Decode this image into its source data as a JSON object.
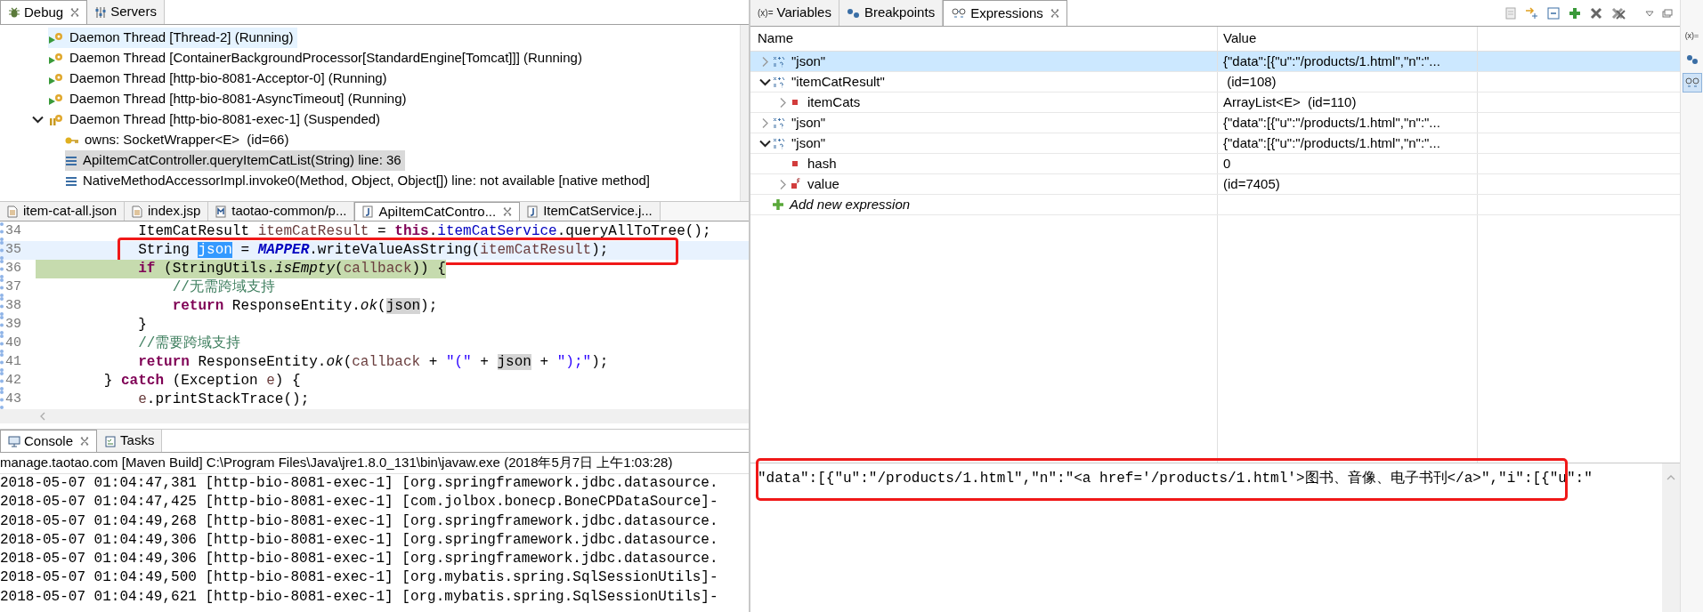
{
  "debug_view": {
    "tabs": [
      {
        "label": "Debug",
        "selected": true
      },
      {
        "label": "Servers",
        "selected": false
      }
    ],
    "threads": [
      {
        "label": "Daemon Thread [Thread-2] (Running)",
        "suspended": false,
        "hovered": true,
        "expanded": false
      },
      {
        "label": "Daemon Thread [ContainerBackgroundProcessor[StandardEngine[Tomcat]]] (Running)",
        "suspended": false,
        "hovered": false,
        "expanded": false
      },
      {
        "label": "Daemon Thread [http-bio-8081-Acceptor-0] (Running)",
        "suspended": false,
        "hovered": false,
        "expanded": false
      },
      {
        "label": "Daemon Thread [http-bio-8081-AsyncTimeout] (Running)",
        "suspended": false,
        "hovered": false,
        "expanded": false
      },
      {
        "label": "Daemon Thread [http-bio-8081-exec-1] (Suspended)",
        "suspended": true,
        "hovered": false,
        "expanded": true,
        "children": [
          {
            "kind": "monitor",
            "label": "owns: SocketWrapper<E>  (id=66)",
            "selected": false
          },
          {
            "kind": "frame",
            "label": "ApiItemCatController.queryItemCatList(String) line: 36",
            "selected": true
          },
          {
            "kind": "frame",
            "label": "NativeMethodAccessorImpl.invoke0(Method, Object, Object[]) line: not available [native method]",
            "selected": false
          }
        ]
      }
    ]
  },
  "editor": {
    "tabs": [
      {
        "label": "item-cat-all.json",
        "kind": "file",
        "selected": false
      },
      {
        "label": "index.jsp",
        "kind": "file",
        "selected": false
      },
      {
        "label": "taotao-common/p...",
        "kind": "maven",
        "selected": false
      },
      {
        "label": "ApiItemCatContro...",
        "kind": "java",
        "selected": true
      },
      {
        "label": "ItemCatService.j...",
        "kind": "java",
        "selected": false
      }
    ],
    "lines": [
      {
        "number": "34",
        "cursor": false,
        "current": false,
        "annotated": false,
        "tokens": [
          {
            "kind": "plain",
            "text": "            ItemCatResult "
          },
          {
            "kind": "local",
            "text": "itemCatResult"
          },
          {
            "kind": "plain",
            "text": " = "
          },
          {
            "kind": "keyword",
            "text": "this"
          },
          {
            "kind": "plain",
            "text": "."
          },
          {
            "kind": "field",
            "text": "itemCatService"
          },
          {
            "kind": "plain",
            "text": ".queryAllToTree();"
          }
        ]
      },
      {
        "number": "35",
        "cursor": true,
        "current": false,
        "annotated": true,
        "tokens": [
          {
            "kind": "plain",
            "text": "            String "
          },
          {
            "kind": "selection",
            "text": "json"
          },
          {
            "kind": "plain",
            "text": " = "
          },
          {
            "kind": "static-field",
            "text": "MAPPER"
          },
          {
            "kind": "plain",
            "text": ".writeValueAsString("
          },
          {
            "kind": "local",
            "text": "itemCatResult"
          },
          {
            "kind": "plain",
            "text": ");"
          }
        ]
      },
      {
        "number": "36",
        "cursor": false,
        "current": true,
        "annotated": false,
        "tokens": [
          {
            "kind": "keyword",
            "text": "            if"
          },
          {
            "kind": "plain",
            "text": " (StringUtils."
          },
          {
            "kind": "static-method",
            "text": "isEmpty"
          },
          {
            "kind": "plain",
            "text": "("
          },
          {
            "kind": "local",
            "text": "callback"
          },
          {
            "kind": "plain",
            "text": ")) {"
          }
        ]
      },
      {
        "number": "37",
        "cursor": false,
        "current": false,
        "annotated": false,
        "tokens": [
          {
            "kind": "comment",
            "text": "                //无需跨域支持"
          }
        ]
      },
      {
        "number": "38",
        "cursor": false,
        "current": false,
        "annotated": false,
        "tokens": [
          {
            "kind": "keyword",
            "text": "                return"
          },
          {
            "kind": "plain",
            "text": " ResponseEntity."
          },
          {
            "kind": "static-method",
            "text": "ok"
          },
          {
            "kind": "plain",
            "text": "("
          },
          {
            "kind": "occurrence",
            "text": "json"
          },
          {
            "kind": "plain",
            "text": ");"
          }
        ]
      },
      {
        "number": "39",
        "cursor": false,
        "current": false,
        "annotated": false,
        "tokens": [
          {
            "kind": "plain",
            "text": "            }"
          }
        ]
      },
      {
        "number": "40",
        "cursor": false,
        "current": false,
        "annotated": false,
        "tokens": [
          {
            "kind": "comment",
            "text": "            //需要跨域支持"
          }
        ]
      },
      {
        "number": "41",
        "cursor": false,
        "current": false,
        "annotated": false,
        "tokens": [
          {
            "kind": "keyword",
            "text": "            return"
          },
          {
            "kind": "plain",
            "text": " ResponseEntity."
          },
          {
            "kind": "static-method",
            "text": "ok"
          },
          {
            "kind": "plain",
            "text": "("
          },
          {
            "kind": "local",
            "text": "callback"
          },
          {
            "kind": "plain",
            "text": " + "
          },
          {
            "kind": "string",
            "text": "\"(\""
          },
          {
            "kind": "plain",
            "text": " + "
          },
          {
            "kind": "occurrence",
            "text": "json"
          },
          {
            "kind": "plain",
            "text": " + "
          },
          {
            "kind": "string",
            "text": "\");\""
          },
          {
            "kind": "plain",
            "text": ");"
          }
        ]
      },
      {
        "number": "42",
        "cursor": false,
        "current": false,
        "annotated": false,
        "tokens": [
          {
            "kind": "plain",
            "text": "        } "
          },
          {
            "kind": "keyword",
            "text": "catch"
          },
          {
            "kind": "plain",
            "text": " (Exception "
          },
          {
            "kind": "local",
            "text": "e"
          },
          {
            "kind": "plain",
            "text": ") {"
          }
        ]
      },
      {
        "number": "43",
        "cursor": false,
        "current": false,
        "annotated": false,
        "tokens": [
          {
            "kind": "local",
            "text": "            e"
          },
          {
            "kind": "plain",
            "text": ".printStackTrace();"
          }
        ]
      }
    ]
  },
  "console_view": {
    "tabs": [
      {
        "label": "Console",
        "kind": "console",
        "selected": true
      },
      {
        "label": "Tasks",
        "kind": "tasks",
        "selected": false
      }
    ],
    "header": "manage.taotao.com [Maven Build] C:\\Program Files\\Java\\jre1.8.0_131\\bin\\javaw.exe (2018年5月7日 上午1:03:28)",
    "lines": [
      "2018-05-07 01:04:47,381 [http-bio-8081-exec-1] [org.springframework.jdbc.datasource.",
      "2018-05-07 01:04:47,425 [http-bio-8081-exec-1] [com.jolbox.bonecp.BoneCPDataSource]-",
      "2018-05-07 01:04:49,268 [http-bio-8081-exec-1] [org.springframework.jdbc.datasource.",
      "2018-05-07 01:04:49,306 [http-bio-8081-exec-1] [org.springframework.jdbc.datasource.",
      "2018-05-07 01:04:49,306 [http-bio-8081-exec-1] [org.springframework.jdbc.datasource.",
      "2018-05-07 01:04:49,500 [http-bio-8081-exec-1] [org.mybatis.spring.SqlSessionUtils]-",
      "2018-05-07 01:04:49,621 [http-bio-8081-exec-1] [org.mybatis.spring.SqlSessionUtils]-"
    ]
  },
  "expressions_view": {
    "tabs": [
      {
        "label": "Variables",
        "kind": "variables",
        "icon_text": "(x)=",
        "selected": false
      },
      {
        "label": "Breakpoints",
        "kind": "breakpoints",
        "selected": false
      },
      {
        "label": "Expressions",
        "kind": "expressions",
        "selected": true
      }
    ],
    "columns": [
      "Name",
      "Value"
    ],
    "rows": [
      {
        "kind": "expression",
        "name": "\"json\"",
        "value": "{\"data\":[{\"u\":\"/products/1.html\",\"n\":\"...",
        "expandable": true,
        "expanded": false,
        "selected": true
      },
      {
        "kind": "expression",
        "name": "\"itemCatResult\"",
        "value": " (id=108)",
        "expandable": true,
        "expanded": true,
        "selected": false,
        "children": [
          {
            "kind": "field",
            "name": "itemCats",
            "value": "ArrayList<E>  (id=110)",
            "expandable": true,
            "expanded": false,
            "selected": false
          }
        ]
      },
      {
        "kind": "expression",
        "name": "\"json\"",
        "value": "{\"data\":[{\"u\":\"/products/1.html\",\"n\":\"...",
        "expandable": true,
        "expanded": false,
        "selected": false
      },
      {
        "kind": "expression",
        "name": "\"json\"",
        "value": "{\"data\":[{\"u\":\"/products/1.html\",\"n\":\"...",
        "expandable": true,
        "expanded": true,
        "selected": false,
        "children": [
          {
            "kind": "field",
            "name": "hash",
            "value": "0",
            "expandable": false,
            "expanded": false,
            "selected": false
          },
          {
            "kind": "final-field",
            "name": "value",
            "value": "(id=7405)",
            "expandable": true,
            "expanded": false,
            "selected": false
          }
        ]
      }
    ],
    "add_label": "Add new expression",
    "detail": {
      "text": "\"data\":[{\"u\":\"/products/1.html\",\"n\":\"<a href='/products/1.html'>图书、音像、电子书刊</a>\",\"i\":[{\"u\":\"",
      "annotated": true
    }
  },
  "side_toolbar": [
    {
      "kind": "variables",
      "icon_text": "(x)=",
      "selected": false
    },
    {
      "kind": "breakpoints",
      "selected": false
    },
    {
      "kind": "expressions",
      "selected": true
    }
  ]
}
